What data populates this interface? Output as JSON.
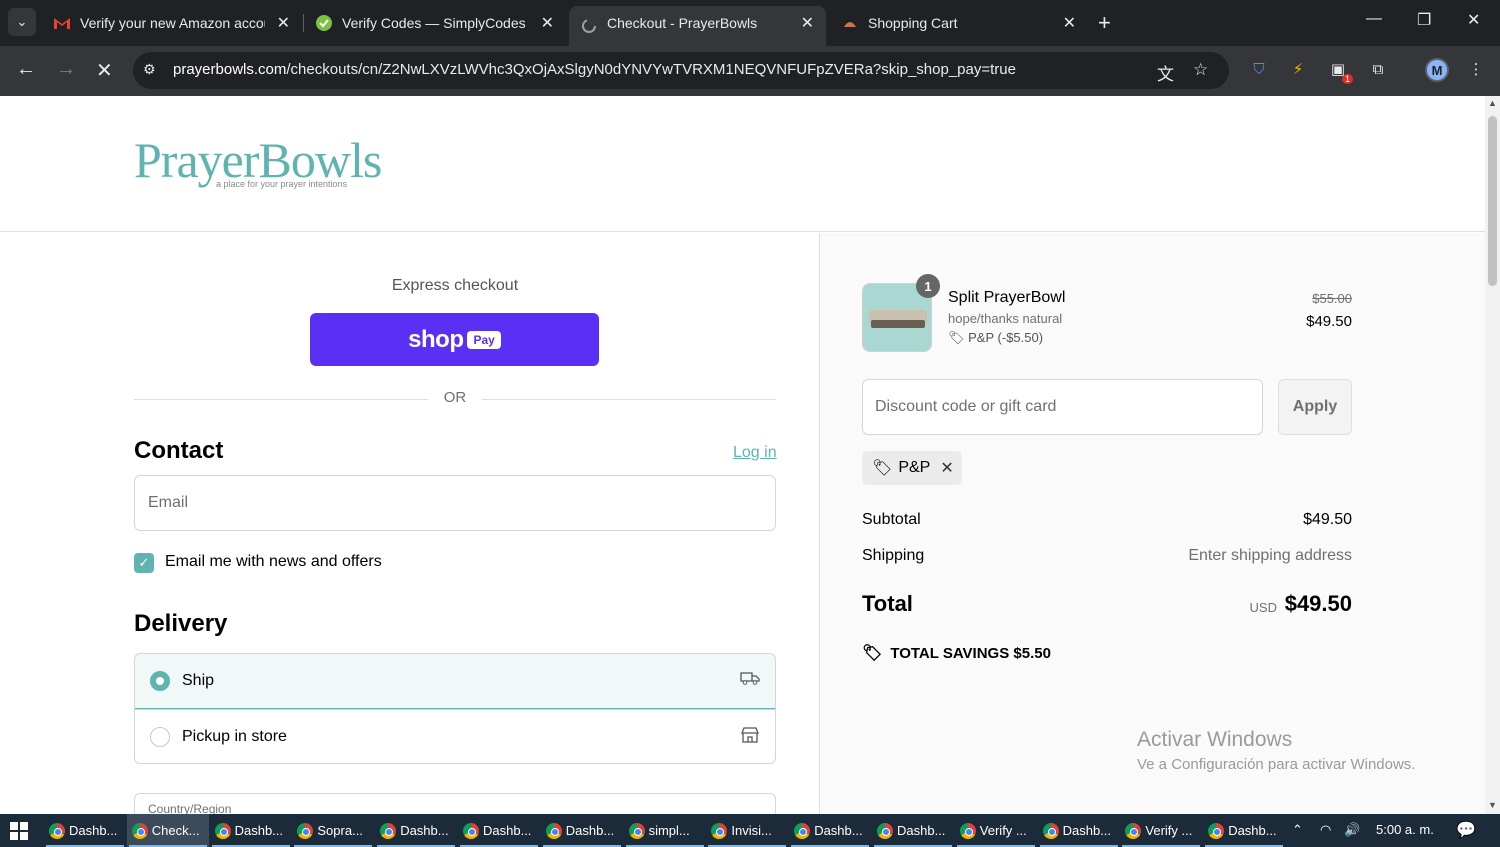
{
  "browser": {
    "tabs": [
      {
        "title": "Verify your new Amazon accoun",
        "icon": "gmail-icon",
        "active": false
      },
      {
        "title": "Verify Codes — SimplyCodes",
        "icon": "simplycodes-icon",
        "active": false
      },
      {
        "title": "Checkout - PrayerBowls",
        "icon": "loading-icon",
        "active": true
      },
      {
        "title": "Shopping Cart",
        "icon": "prayerbowls-icon",
        "active": false
      }
    ],
    "url_host": "prayerbowls.com",
    "url_path": "/checkouts/cn/Z2NwLXVzLWVhc3QxOjAxSlgyN0dYNVYwTVRXM1NEQVNFUFpZVERa?skip_shop_pay=true",
    "profile_initial": "M",
    "extension_badge": "1"
  },
  "store": {
    "logo_text": "PrayerBowls",
    "logo_tagline": "a place for your prayer intentions"
  },
  "checkout": {
    "express_label": "Express checkout",
    "shop_pay_word": "shop",
    "shop_pay_pill": "Pay",
    "or_text": "OR",
    "contact_heading": "Contact",
    "login_link": "Log in",
    "email_placeholder": "Email",
    "news_checkbox_label": "Email me with news and offers",
    "news_checked": true,
    "delivery_heading": "Delivery",
    "delivery_options": [
      {
        "label": "Ship",
        "selected": true,
        "icon": "truck-icon"
      },
      {
        "label": "Pickup in store",
        "selected": false,
        "icon": "store-icon"
      }
    ],
    "country_label": "Country/Region"
  },
  "summary": {
    "product": {
      "name": "Split PrayerBowl",
      "variant": "hope/thanks natural",
      "discount_line": "P&P (-$5.50)",
      "quantity": "1",
      "price_original": "$55.00",
      "price_final": "$49.50"
    },
    "discount_placeholder": "Discount code or gift card",
    "apply_label": "Apply",
    "applied_code": "P&P",
    "subtotal_label": "Subtotal",
    "subtotal_value": "$49.50",
    "shipping_label": "Shipping",
    "shipping_value": "Enter shipping address",
    "total_label": "Total",
    "total_currency": "USD",
    "total_value": "$49.50",
    "savings_label": "TOTAL SAVINGS",
    "savings_value": "$5.50"
  },
  "windows_notice": {
    "line1": "Activar Windows",
    "line2": "Ve a Configuración para activar Windows."
  },
  "taskbar": {
    "items": [
      "Dashb...",
      "Check...",
      "Dashb...",
      "Sopra...",
      "Dashb...",
      "Dashb...",
      "Dashb...",
      "simpl...",
      "Invisi...",
      "Dashb...",
      "Dashb...",
      "Verify ...",
      "Dashb...",
      "Verify ...",
      "Dashb..."
    ],
    "active_index": 1,
    "clock": "5:00 a. m."
  },
  "colors": {
    "accent": "#5fb3b0",
    "shop_pay": "#5a31f4",
    "chrome_dark": "#202124",
    "chrome_toolbar": "#35363a"
  }
}
